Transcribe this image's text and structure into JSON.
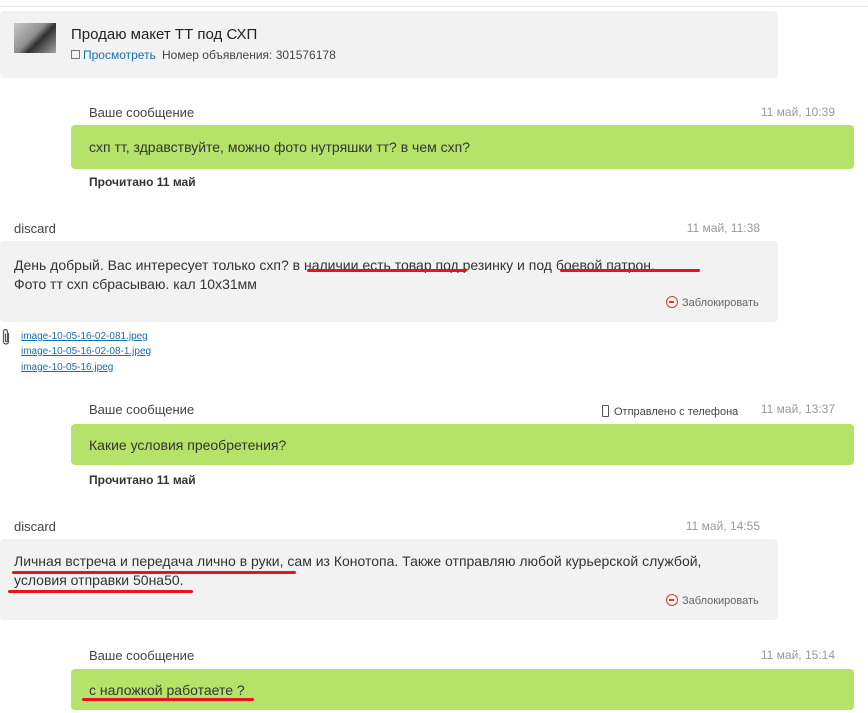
{
  "ad": {
    "title": "Продаю макет ТТ под СХП",
    "view_label": "Просмотреть",
    "number_label": "Номер объявления: 301576178"
  },
  "messages": [
    {
      "author": "Ваше сообщение",
      "time": "11 май, 10:39",
      "text": "схп тт, здравствуйте, можно фото нутряшки тт? в чем схп?",
      "status": "Прочитано 11 май"
    },
    {
      "author": "discard",
      "time": "11 май, 11:38",
      "segments": [
        "День добрый. Вас интересует только схп? ",
        "в наличии есть товар",
        " под резинку и ",
        "под боевой патрон.",
        ""
      ],
      "line2": "Фото тт схп сбрасываю. кал 10х31мм",
      "block_label": "Заблокировать",
      "attachments": [
        "image-10-05-16-02-081.jpeg",
        "image-10-05-16-02-08-1.jpeg",
        "image-10-05-16.jpeg"
      ]
    },
    {
      "author": "Ваше сообщение",
      "phone_note": "Отправлено с телефона",
      "time": "11 май, 13:37",
      "text": "Какие условия преобретения?",
      "status": "Прочитано 11 май"
    },
    {
      "author": "discard",
      "time": "11 май, 14:55",
      "line1_a": "Личная встреча и передача лично в руки",
      "line1_b": ", сам из Конотопа. Также отправляю любой курьерской службой,",
      "line2": "условия отправки 50на50.",
      "block_label": "Заблокировать"
    },
    {
      "author": "Ваше сообщение",
      "time": "11 май, 15:14",
      "text": "с наложкой работаете ?"
    }
  ],
  "icons": {
    "external_link": "external-link-icon",
    "block": "block-icon",
    "paperclip": "paperclip-icon",
    "phone": "phone-icon"
  },
  "colors": {
    "own_bubble": "#b5e36a",
    "other_bubble": "#f2f2f2",
    "link": "#1a6fb0",
    "underline_mark": "#e8131e",
    "block_icon": "#d23c2a"
  }
}
